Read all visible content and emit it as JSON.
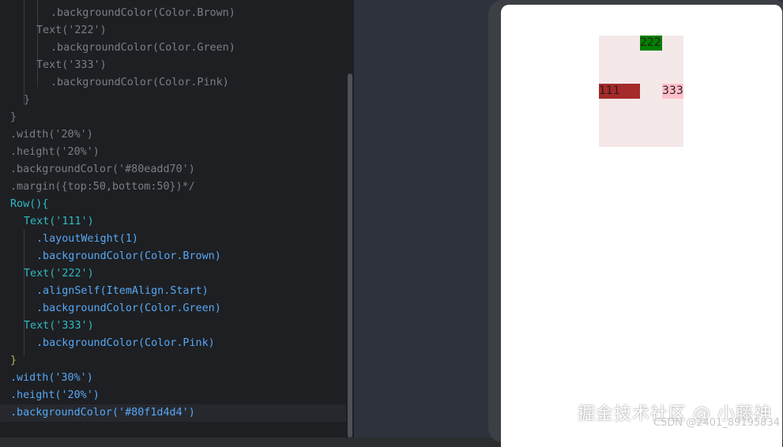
{
  "editor": {
    "lines": [
      ".backgroundColor(Color.Brown)",
      "Text('222')",
      ".backgroundColor(Color.Green)",
      "Text('333')",
      ".backgroundColor(Color.Pink)",
      "}",
      "}",
      ".width('20%')",
      ".height('20%')",
      ".backgroundColor('#80eadd70')",
      ".margin({top:50,bottom:50})*/",
      "Row(){",
      "Text('111')",
      ".layoutWeight(1)",
      ".backgroundColor(Color.Brown)",
      "Text('222')",
      ".alignSelf(ItemAlign.Start)",
      ".backgroundColor(Color.Green)",
      "Text('333')",
      ".backgroundColor(Color.Pink)",
      "}",
      ".width('30%')",
      ".height('20%')",
      ".backgroundColor('#80f1d4d4')"
    ]
  },
  "preview": {
    "row_background": "#f5e8e8",
    "items": [
      {
        "label": "111",
        "color": "#a52a2a"
      },
      {
        "label": "222",
        "color": "#008000"
      },
      {
        "label": "333",
        "color": "#ffc0cb"
      }
    ]
  },
  "watermark": {
    "main": "掘金技术社区 @ 小藤神",
    "sub": "CSDN @2401_89195834"
  }
}
